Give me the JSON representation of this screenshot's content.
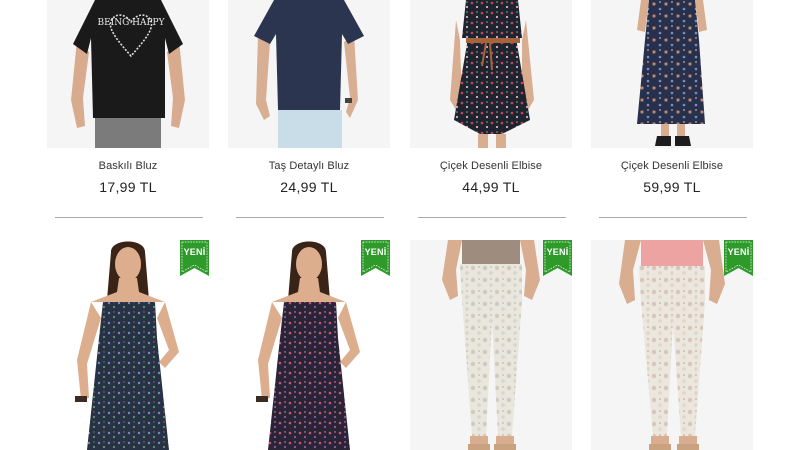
{
  "products_row1": [
    {
      "name": "Baskılı Bluz",
      "price": "17,99 TL",
      "print": "BEING HAPPY"
    },
    {
      "name": "Taş Detaylı Bluz",
      "price": "24,99 TL"
    },
    {
      "name": "Çiçek Desenli Elbise",
      "price": "44,99 TL"
    },
    {
      "name": "Çiçek Desenli Elbise",
      "price": "59,99 TL"
    }
  ],
  "products_row2": [
    {
      "badge": "YENİ"
    },
    {
      "badge": "YENİ"
    },
    {
      "badge": "YENİ"
    },
    {
      "badge": "YENİ"
    }
  ],
  "colors": {
    "badge_green": "#2e9a2a",
    "divider": "#a9a9a9"
  }
}
